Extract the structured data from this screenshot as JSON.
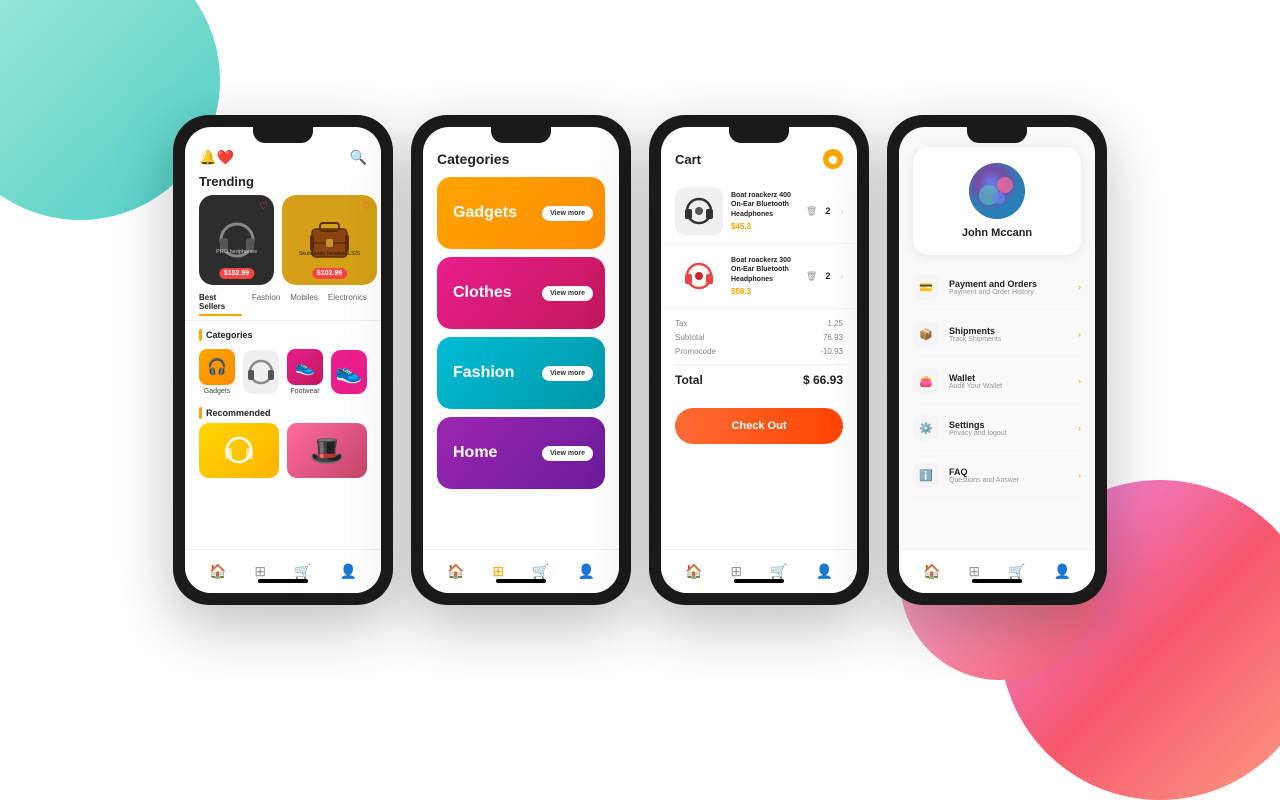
{
  "background": {
    "topLeft": "teal-gradient",
    "bottomRight": "pink-gradient"
  },
  "phone1": {
    "trending_label": "Trending",
    "products": [
      {
        "name": "PRO hedphones",
        "price": "$152.99"
      },
      {
        "name": "Skullcandy headset L325",
        "price": "$102.99"
      }
    ],
    "tabs": [
      "Best Sellers",
      "Fashion",
      "Mobiles",
      "Electronics"
    ],
    "categories_label": "Categories",
    "categories": [
      "Gadgets",
      "Footwear"
    ],
    "recommended_label": "Recommended"
  },
  "phone2": {
    "title": "Categories",
    "categories": [
      {
        "name": "Gadgets",
        "view_more": "View more"
      },
      {
        "name": "Clothes",
        "view_more": "View more"
      },
      {
        "name": "Fashion",
        "view_more": "View more"
      },
      {
        "name": "Home",
        "view_more": "View more"
      }
    ]
  },
  "phone3": {
    "title": "Cart",
    "items": [
      {
        "name": "Boat roackerz 400 On-Ear Bluetooth Headphones",
        "price": "$45.3",
        "qty": "2"
      },
      {
        "name": "Boat roackerz 300 On-Ear Bluetooth Headphones",
        "price": "$58.3",
        "qty": "2"
      }
    ],
    "tax_label": "Tax",
    "tax_value": "1.25",
    "subtotal_label": "Subtotal",
    "subtotal_value": "76.93",
    "promo_label": "Promocode",
    "promo_value": "-10.93",
    "total_label": "Total",
    "total_value": "$ 66.93",
    "checkout_btn": "Check Out"
  },
  "phone4": {
    "username": "John Mccann",
    "menu_items": [
      {
        "title": "Payment and Orders",
        "subtitle": "Payment and Order History",
        "icon": "💳"
      },
      {
        "title": "Shipments",
        "subtitle": "Track Shipments",
        "icon": "📦"
      },
      {
        "title": "Wallet",
        "subtitle": "Audit Your Wallet",
        "icon": "👛"
      },
      {
        "title": "Settings",
        "subtitle": "Privacy and logout",
        "icon": "⚙️"
      },
      {
        "title": "FAQ",
        "subtitle": "Questions and Answer",
        "icon": "ℹ️"
      }
    ]
  },
  "nav": {
    "icons": [
      "🏠",
      "⊞",
      "🛒",
      "👤"
    ]
  }
}
